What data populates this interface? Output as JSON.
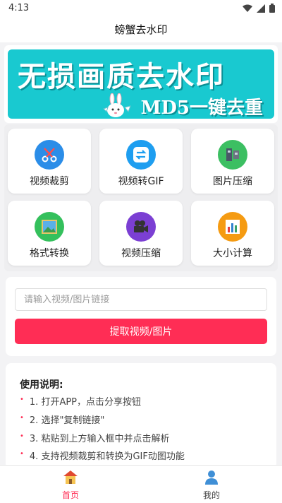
{
  "status_bar": {
    "time": "4:13"
  },
  "app": {
    "title": "螃蟹去水印"
  },
  "banner": {
    "headline": "无损画质去水印",
    "subline": "MD5一键去重"
  },
  "tools": [
    {
      "label": "视频裁剪",
      "icon": "scissors-icon",
      "color": "#2b8de8"
    },
    {
      "label": "视频转GIF",
      "icon": "convert-icon",
      "color": "#1e9ef0"
    },
    {
      "label": "图片压缩",
      "icon": "compress-icon",
      "color": "#3cbf62"
    },
    {
      "label": "格式转换",
      "icon": "picture-icon",
      "color": "#34c05c"
    },
    {
      "label": "视频压缩",
      "icon": "video-camera-icon",
      "color": "#7b3fd3"
    },
    {
      "label": "大小计算",
      "icon": "bar-chart-icon",
      "color": "#f59b12"
    }
  ],
  "parser": {
    "input_placeholder": "请输入视频/图片链接",
    "input_value": "",
    "button_label": "提取视频/图片"
  },
  "instructions": {
    "title": "使用说明:",
    "steps": [
      "1. 打开APP，点击分享按钮",
      "2. 选择\"复制链接\"",
      "3. 粘贴到上方输入框中并点击解析",
      "4. 支持视频裁剪和转换为GIF动图功能"
    ]
  },
  "tabbar": {
    "items": [
      {
        "label": "首页",
        "icon": "home-icon",
        "active": true
      },
      {
        "label": "我的",
        "icon": "user-icon",
        "active": false
      }
    ],
    "active_color": "#ff2d55"
  },
  "colors": {
    "accent": "#ff2d55",
    "banner": "#19c9d0"
  }
}
